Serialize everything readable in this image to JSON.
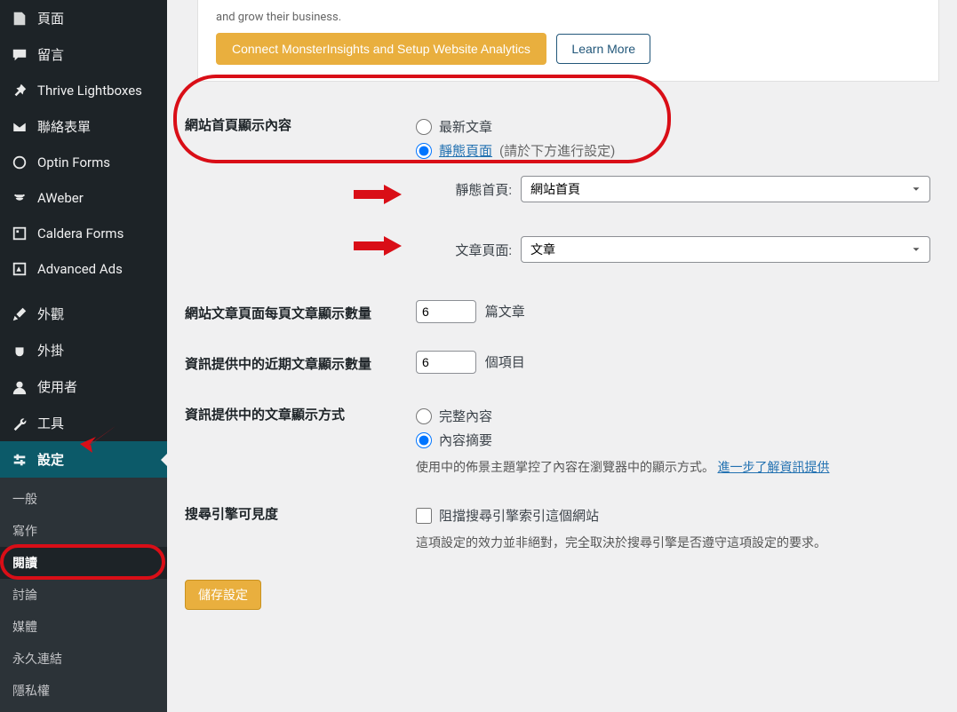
{
  "sidebar": {
    "items": [
      {
        "label": "頁面",
        "icon": "page-icon"
      },
      {
        "label": "留言",
        "icon": "comments-icon"
      },
      {
        "label": "Thrive Lightboxes",
        "icon": "pin-icon"
      },
      {
        "label": "聯絡表單",
        "icon": "mail-icon"
      },
      {
        "label": "Optin Forms",
        "icon": "circle-icon"
      },
      {
        "label": "AWeber",
        "icon": "broadcast-icon"
      },
      {
        "label": "Caldera Forms",
        "icon": "form-icon"
      },
      {
        "label": "Advanced Ads",
        "icon": "megaphone-icon"
      },
      {
        "label": "外觀",
        "icon": "brush-icon"
      },
      {
        "label": "外掛",
        "icon": "plugin-icon"
      },
      {
        "label": "使用者",
        "icon": "user-icon"
      },
      {
        "label": "工具",
        "icon": "wrench-icon"
      },
      {
        "label": "設定",
        "icon": "settings-icon"
      }
    ],
    "sub": [
      {
        "label": "一般"
      },
      {
        "label": "寫作"
      },
      {
        "label": "閱讀"
      },
      {
        "label": "討論"
      },
      {
        "label": "媒體"
      },
      {
        "label": "永久連結"
      },
      {
        "label": "隱私權"
      }
    ]
  },
  "banner": {
    "tail_text": "and grow their business.",
    "cta_label": "Connect MonsterInsights and Setup Website Analytics",
    "learn_label": "Learn More"
  },
  "homepage": {
    "label": "網站首頁顯示內容",
    "opt_latest": "最新文章",
    "opt_static": "靜態頁面",
    "opt_static_hint": "(請於下方進行設定)",
    "static_home_label": "靜態首頁:",
    "static_home_value": "網站首頁",
    "posts_page_label": "文章頁面:",
    "posts_page_value": "文章"
  },
  "posts_per_page": {
    "label": "網站文章頁面每頁文章顯示數量",
    "value": "6",
    "unit": "篇文章"
  },
  "feed_items": {
    "label": "資訊提供中的近期文章顯示數量",
    "value": "6",
    "unit": "個項目"
  },
  "feed_content": {
    "label": "資訊提供中的文章顯示方式",
    "full": "完整內容",
    "excerpt": "內容摘要",
    "desc_pre": "使用中的佈景主題掌控了內容在瀏覽器中的顯示方式。",
    "desc_link": "進一步了解資訊提供"
  },
  "seo": {
    "label": "搜尋引擎可見度",
    "checkbox_label": "阻擋搜尋引擎索引這個網站",
    "desc": "這項設定的效力並非絕對，完全取決於搜尋引擎是否遵守這項設定的要求。"
  },
  "save_label": "儲存設定"
}
